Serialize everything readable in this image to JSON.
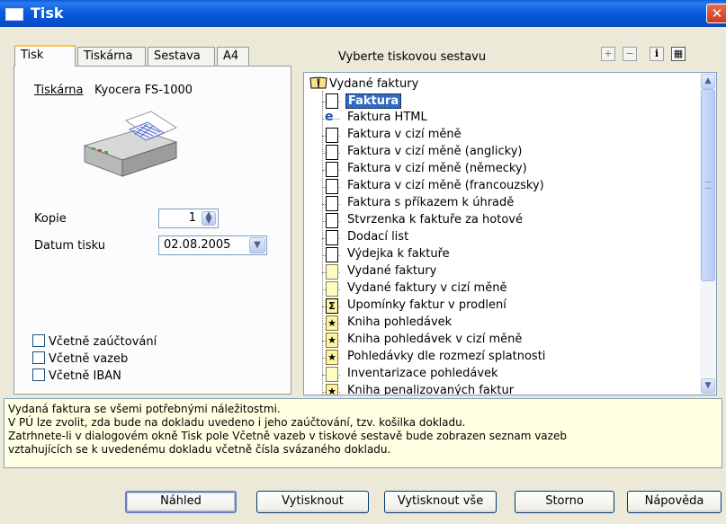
{
  "window": {
    "title": "Tisk",
    "close_label": "✕"
  },
  "tabs": [
    "Tisk",
    "Tiskárna",
    "Sestava",
    "A4"
  ],
  "printer": {
    "label": "Tiskárna",
    "name": "Kyocera FS-1000"
  },
  "copies": {
    "label": "Kopie",
    "value": "1"
  },
  "print_date": {
    "label": "Datum tisku",
    "value": "02.08.2005"
  },
  "checkboxes": [
    "Včetně zaúčtování",
    "Včetně vazeb",
    "Včetně IBAN"
  ],
  "report_panel": {
    "label": "Vyberte tiskovou sestavu"
  },
  "toolbar_icons": [
    "plus-icon",
    "minus-icon",
    "info-icon",
    "properties-icon"
  ],
  "tree": {
    "root": "Vydané faktury",
    "items": [
      {
        "label": "Faktura",
        "icon": "doc",
        "selected": true
      },
      {
        "label": "Faktura HTML",
        "icon": "ie"
      },
      {
        "label": "Faktura v cizí měně",
        "icon": "doc"
      },
      {
        "label": "Faktura v cizí měně (anglicky)",
        "icon": "doc"
      },
      {
        "label": "Faktura v cizí měně (německy)",
        "icon": "doc"
      },
      {
        "label": "Faktura v cizí měně (francouzsky)",
        "icon": "doc"
      },
      {
        "label": "Faktura s příkazem k úhradě",
        "icon": "doc"
      },
      {
        "label": "Stvrzenka k faktuře za hotové",
        "icon": "doc"
      },
      {
        "label": "Dodací list",
        "icon": "doc"
      },
      {
        "label": "Výdejka k faktuře",
        "icon": "doc"
      },
      {
        "label": "Vydané faktury",
        "icon": "yellow"
      },
      {
        "label": "Vydané faktury v cizí měně",
        "icon": "yellow"
      },
      {
        "label": "Upomínky faktur v prodlení",
        "icon": "sigma"
      },
      {
        "label": "Kniha pohledávek",
        "icon": "star"
      },
      {
        "label": "Kniha pohledávek v cizí měně",
        "icon": "star"
      },
      {
        "label": "Pohledávky dle rozmezí splatnosti",
        "icon": "star"
      },
      {
        "label": "Inventarizace pohledávek",
        "icon": "yellow"
      },
      {
        "label": "Kniha penalizovaných faktur",
        "icon": "star"
      }
    ]
  },
  "description": [
    "Vydaná faktura se všemi potřebnými náležitostmi.",
    "V PÚ lze zvolit, zda bude na dokladu uvedeno i jeho zaúčtování, tzv. košilka dokladu.",
    "Zatrhnete-li v dialogovém okně Tisk pole Včetně vazeb v tiskové sestavě bude zobrazen seznam vazeb",
    "vztahujících se k uvedenému dokladu včetně čísla svázaného dokladu."
  ],
  "buttons": {
    "preview": "Náhled",
    "print": "Vytisknout",
    "print_all": "Vytisknout vše",
    "cancel": "Storno",
    "help": "Nápověda"
  }
}
